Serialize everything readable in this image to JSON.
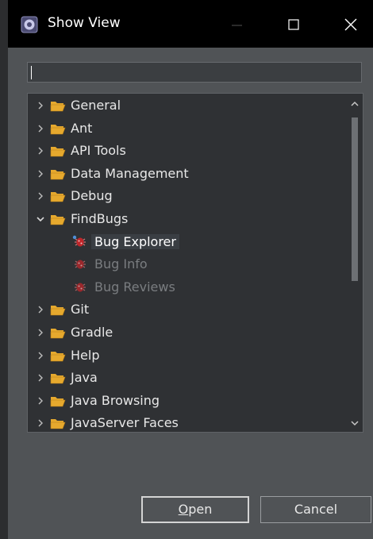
{
  "window": {
    "title": "Show View",
    "icon": "eclipse-icon"
  },
  "filter": {
    "value": "",
    "placeholder": ""
  },
  "tree": {
    "items": [
      {
        "label": "General",
        "type": "folder",
        "expanded": false
      },
      {
        "label": "Ant",
        "type": "folder",
        "expanded": false
      },
      {
        "label": "API Tools",
        "type": "folder",
        "expanded": false
      },
      {
        "label": "Data Management",
        "type": "folder",
        "expanded": false
      },
      {
        "label": "Debug",
        "type": "folder",
        "expanded": false
      },
      {
        "label": "FindBugs",
        "type": "folder",
        "expanded": true
      },
      {
        "label": "Bug Explorer",
        "type": "view",
        "selected": true,
        "enabled": true
      },
      {
        "label": "Bug Info",
        "type": "view",
        "enabled": false
      },
      {
        "label": "Bug Reviews",
        "type": "view",
        "enabled": false
      },
      {
        "label": "Git",
        "type": "folder",
        "expanded": false
      },
      {
        "label": "Gradle",
        "type": "folder",
        "expanded": false
      },
      {
        "label": "Help",
        "type": "folder",
        "expanded": false
      },
      {
        "label": "Java",
        "type": "folder",
        "expanded": false
      },
      {
        "label": "Java Browsing",
        "type": "folder",
        "expanded": false
      },
      {
        "label": "JavaServer Faces",
        "type": "folder",
        "expanded": false
      }
    ]
  },
  "buttons": {
    "open_mnemonic": "O",
    "open_rest": "pen",
    "cancel": "Cancel"
  },
  "colors": {
    "folder": "#e6a92e",
    "dialog_bg": "#505356",
    "tree_bg": "#2f3134",
    "titlebar_bg": "#000000"
  }
}
